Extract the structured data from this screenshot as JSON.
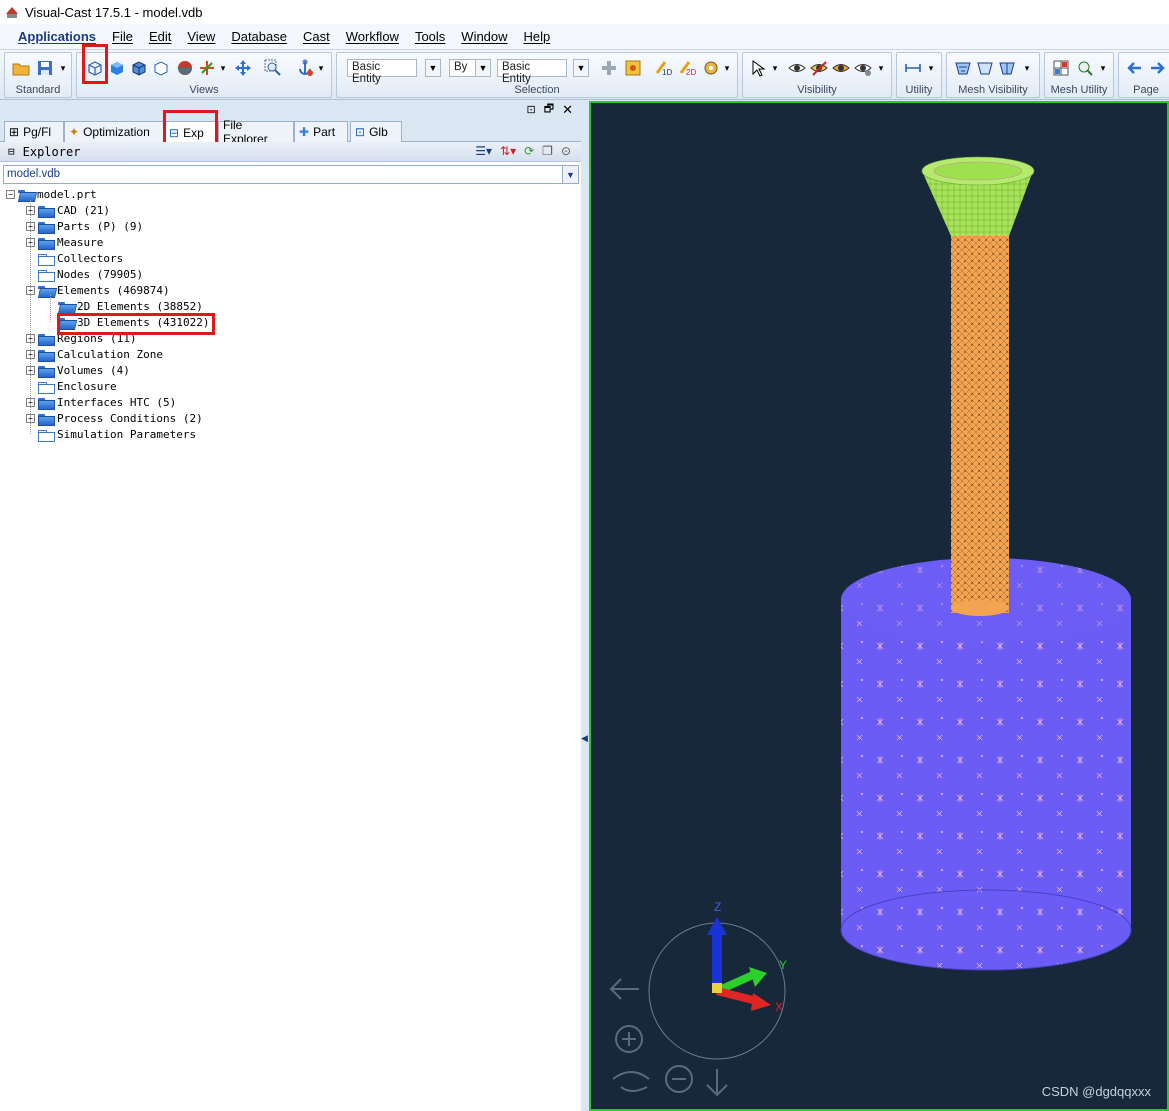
{
  "window": {
    "title": "Visual-Cast 17.5.1 - model.vdb"
  },
  "menu": [
    "Applications",
    "File",
    "Edit",
    "View",
    "Database",
    "Cast",
    "Workflow",
    "Tools",
    "Window",
    "Help"
  ],
  "toolbar": {
    "groups": {
      "standard": "Standard",
      "views": "Views",
      "selection": "Selection",
      "visibility": "Visibility",
      "utility": "Utility",
      "mesh_visibility": "Mesh Visibility",
      "mesh_utility": "Mesh Utility",
      "page": "Page"
    },
    "selection": {
      "filter1": "Basic Entity",
      "by": "By",
      "filter2": "Basic Entity"
    }
  },
  "tabs": [
    "Pg/Fl",
    "Optimization",
    "Exp",
    "File Explorer",
    "Part",
    "Glb"
  ],
  "explorer": {
    "title": "Explorer",
    "file": "model.vdb",
    "tree": [
      {
        "label": "model.prt",
        "level": 0,
        "toggle": "-",
        "folder": "open"
      },
      {
        "label": "CAD (21)",
        "level": 1,
        "toggle": "+",
        "folder": "closed"
      },
      {
        "label": "Parts (P) (9)",
        "level": 1,
        "toggle": "+",
        "folder": "closed"
      },
      {
        "label": "Measure",
        "level": 1,
        "toggle": "+",
        "folder": "closed"
      },
      {
        "label": "Collectors",
        "level": 1,
        "toggle": "",
        "folder": "empty"
      },
      {
        "label": "Nodes (79905)",
        "level": 1,
        "toggle": "",
        "folder": "empty"
      },
      {
        "label": "Elements (469874)",
        "level": 1,
        "toggle": "-",
        "folder": "open"
      },
      {
        "label": "2D Elements (38852)",
        "level": 2,
        "toggle": "",
        "folder": "open"
      },
      {
        "label": "3D Elements (431022)",
        "level": 2,
        "toggle": "",
        "folder": "open"
      },
      {
        "label": "Regions (11)",
        "level": 1,
        "toggle": "+",
        "folder": "closed"
      },
      {
        "label": "Calculation Zone",
        "level": 1,
        "toggle": "+",
        "folder": "closed"
      },
      {
        "label": "Volumes (4)",
        "level": 1,
        "toggle": "+",
        "folder": "closed"
      },
      {
        "label": "Enclosure",
        "level": 1,
        "toggle": "",
        "folder": "empty"
      },
      {
        "label": "Interfaces HTC (5)",
        "level": 1,
        "toggle": "+",
        "folder": "closed"
      },
      {
        "label": "Process Conditions (2)",
        "level": 1,
        "toggle": "+",
        "folder": "closed"
      },
      {
        "label": "Simulation Parameters",
        "level": 1,
        "toggle": "",
        "folder": "empty"
      }
    ]
  },
  "viewport": {
    "axes": {
      "x": "X",
      "y": "Y",
      "z": "Z"
    },
    "colors": {
      "background": "#17283b",
      "funnel": "#9ee04e",
      "sprue": "#f2a451",
      "cylinder": "#6b5cf5",
      "border": "#35c035"
    }
  },
  "watermark": "CSDN @dgdqqxxx"
}
